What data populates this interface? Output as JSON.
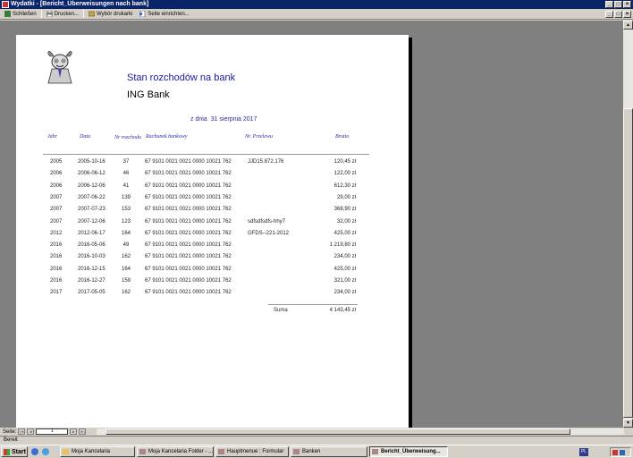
{
  "window": {
    "title": "Wydatki - [Bericht_Überweisungen nach bank]",
    "controls": [
      "_",
      "□",
      "×"
    ],
    "mdi_controls": [
      "_",
      "□",
      "×"
    ]
  },
  "toolbar": {
    "close_label": "Schließen",
    "print_label": "Drucken...",
    "printer_choice_label": "Wybór drukarki",
    "page_setup_label": "Seite einrichten..."
  },
  "report": {
    "title": "Stan rozchodów na bank",
    "bank": "ING Bank",
    "date_prefix": "z dnia",
    "date": "31 sierpnia 2017",
    "columns": {
      "year": "Jahr",
      "date": "Data",
      "nr": "Nr rozchodu",
      "account": "Rachunek bankowy",
      "ref": "Nr. Przelewu",
      "amount": "Brutto"
    },
    "rows": [
      {
        "year": "2005",
        "date": "2005-10-16",
        "nr": "37",
        "account": "67 9101 0021 0021 0000 10021 762",
        "ref": "JJD15.872.176",
        "amount": "120,45 zł"
      },
      {
        "year": "2006",
        "date": "2006-06-12",
        "nr": "46",
        "account": "67 9101 0021 0021 0000 10021 762",
        "ref": "",
        "amount": "122,00 zł"
      },
      {
        "year": "2006",
        "date": "2006-12-06",
        "nr": "41",
        "account": "67 9101 0021 0021 0000 10021 762",
        "ref": "",
        "amount": "612,30 zł"
      },
      {
        "year": "2007",
        "date": "2007-06-22",
        "nr": "139",
        "account": "67 9101 0021 0021 0000 10021 762",
        "ref": "",
        "amount": "29,00 zł"
      },
      {
        "year": "2007",
        "date": "2007-07-23",
        "nr": "153",
        "account": "67 9101 0021 0021 0000 10021 762",
        "ref": "",
        "amount": "368,90 zł"
      },
      {
        "year": "2007",
        "date": "2007-12-06",
        "nr": "123",
        "account": "67 9101 0021 0021 0000 10021 762",
        "ref": "sdfsdfsdfs-hhy7",
        "amount": "32,00 zł"
      },
      {
        "year": "2012",
        "date": "2012-06-17",
        "nr": "164",
        "account": "67 9101 0021 0021 0000 10021 762",
        "ref": "GFDS--221-2012",
        "amount": "425,00 zł"
      },
      {
        "year": "2016",
        "date": "2016-05-06",
        "nr": "49",
        "account": "67 9101 0021 0021 0000 10021 762",
        "ref": "",
        "amount": "1 219,80 zł"
      },
      {
        "year": "2016",
        "date": "2016-10-03",
        "nr": "162",
        "account": "67 9101 0021 0021 0000 10021 762",
        "ref": "",
        "amount": "234,00 zł"
      },
      {
        "year": "2016",
        "date": "2016-12-15",
        "nr": "164",
        "account": "67 9101 0021 0021 0000 10021 762",
        "ref": "",
        "amount": "425,00 zł"
      },
      {
        "year": "2016",
        "date": "2016-12-27",
        "nr": "159",
        "account": "67 9101 0021 0021 0000 10021 762",
        "ref": "",
        "amount": "321,00 zł"
      },
      {
        "year": "2017",
        "date": "2017-05-05",
        "nr": "162",
        "account": "67 9101 0021 0021 0000 10021 762",
        "ref": "",
        "amount": "234,00 zł"
      }
    ],
    "sum_label": "Suma",
    "sum_value": "4 143,45 zł"
  },
  "navigation": {
    "label": "Seite:",
    "page_value": "1",
    "buttons": [
      "|◄",
      "◄",
      "►",
      "►|"
    ]
  },
  "status": {
    "text": "Bereit"
  },
  "taskbar": {
    "start_label": "Start",
    "tasks": [
      "Moja Kancelaria",
      "Moja Kancelaria Folder - ...",
      "Hauptmenue : Formular",
      "Banken",
      "Bericht_Überweisung..."
    ],
    "lang": "PL"
  },
  "colors": {
    "title_bar": "#0a246a",
    "report_title": "#1a1a9a",
    "column_header": "#2828a8",
    "workspace": "#808080"
  }
}
